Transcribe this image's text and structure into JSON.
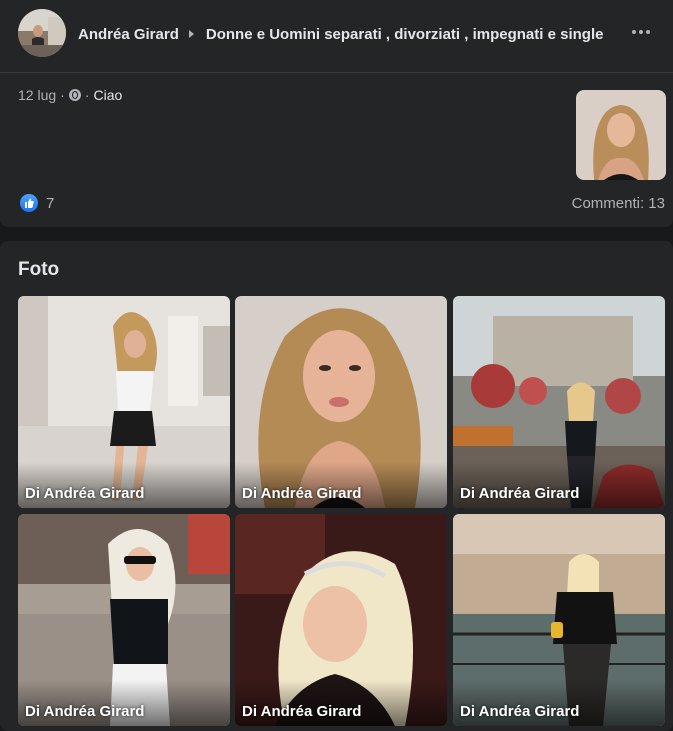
{
  "post": {
    "author": "Andréa Girard",
    "group": "Donne e Uomini separati , divorziati , impegnati e single",
    "date": "12 lug",
    "message": "Ciao",
    "reaction_count": "7",
    "comments": "Commenti: 13"
  },
  "photos": {
    "title": "Foto",
    "items": [
      {
        "caption": "Di Andréa Girard"
      },
      {
        "caption": "Di Andréa Girard"
      },
      {
        "caption": "Di Andréa Girard"
      },
      {
        "caption": "Di Andréa Girard"
      },
      {
        "caption": "Di Andréa Girard"
      },
      {
        "caption": "Di Andréa Girard"
      }
    ]
  },
  "colors": {
    "background": "#18191a",
    "card": "#242526",
    "like_blue": "#1877f2",
    "secondary_text": "#b0b3b8"
  }
}
